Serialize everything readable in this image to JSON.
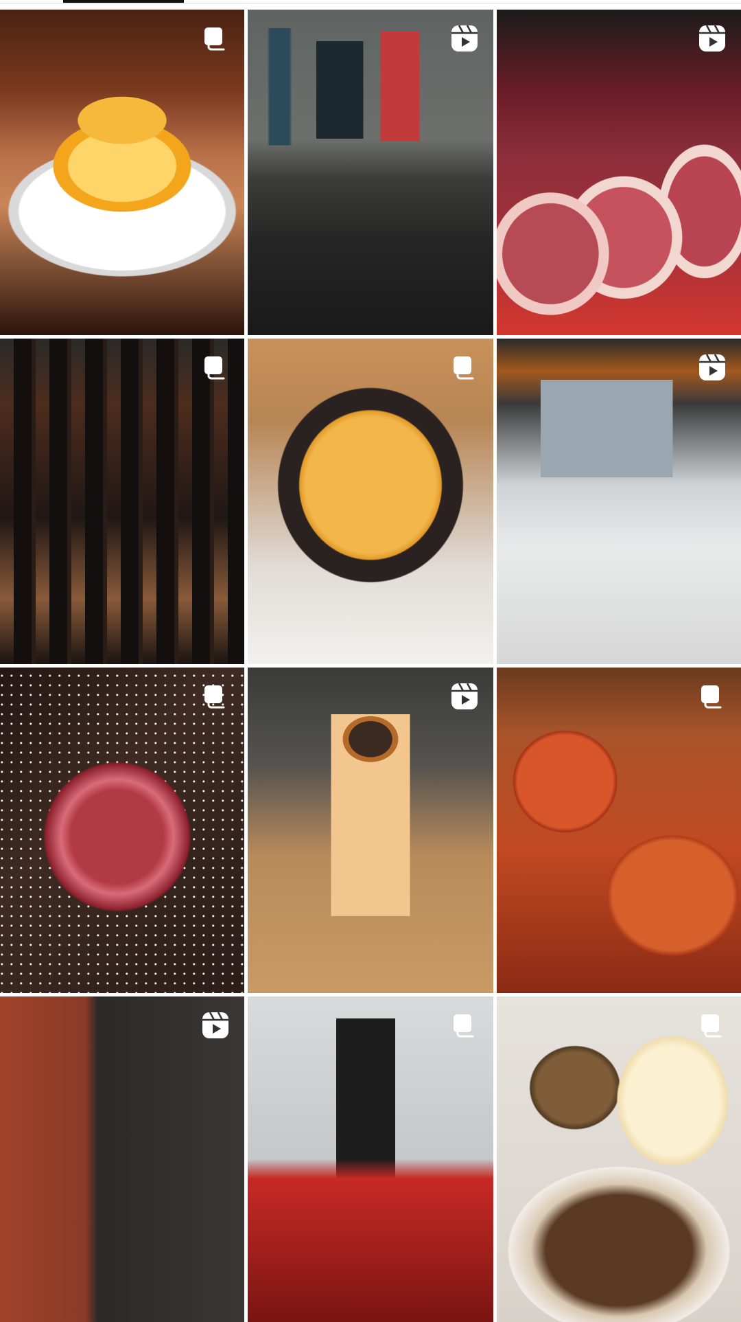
{
  "profile_grid": {
    "active_tab": "posts",
    "posts": [
      {
        "id": "flan",
        "badge": "carousel"
      },
      {
        "id": "dining-room",
        "badge": "reel"
      },
      {
        "id": "raw-meat-cuts",
        "badge": "reel"
      },
      {
        "id": "wine-shelf",
        "badge": "carousel"
      },
      {
        "id": "baked-cheese",
        "badge": "carousel"
      },
      {
        "id": "butcher-shop",
        "badge": "reel"
      },
      {
        "id": "ribeye-steak",
        "badge": "carousel"
      },
      {
        "id": "cocktail",
        "badge": "reel"
      },
      {
        "id": "lasagna",
        "badge": "carousel"
      },
      {
        "id": "patio",
        "badge": "reel"
      },
      {
        "id": "neon-sign-chef",
        "badge": "carousel"
      },
      {
        "id": "dessert",
        "badge": "carousel"
      }
    ]
  },
  "icons": {
    "carousel": "carousel-icon",
    "reel": "reel-icon"
  },
  "colors": {
    "background": "#ffffff",
    "tab_indicator": "#111111",
    "badge_fill": "#ffffff"
  }
}
